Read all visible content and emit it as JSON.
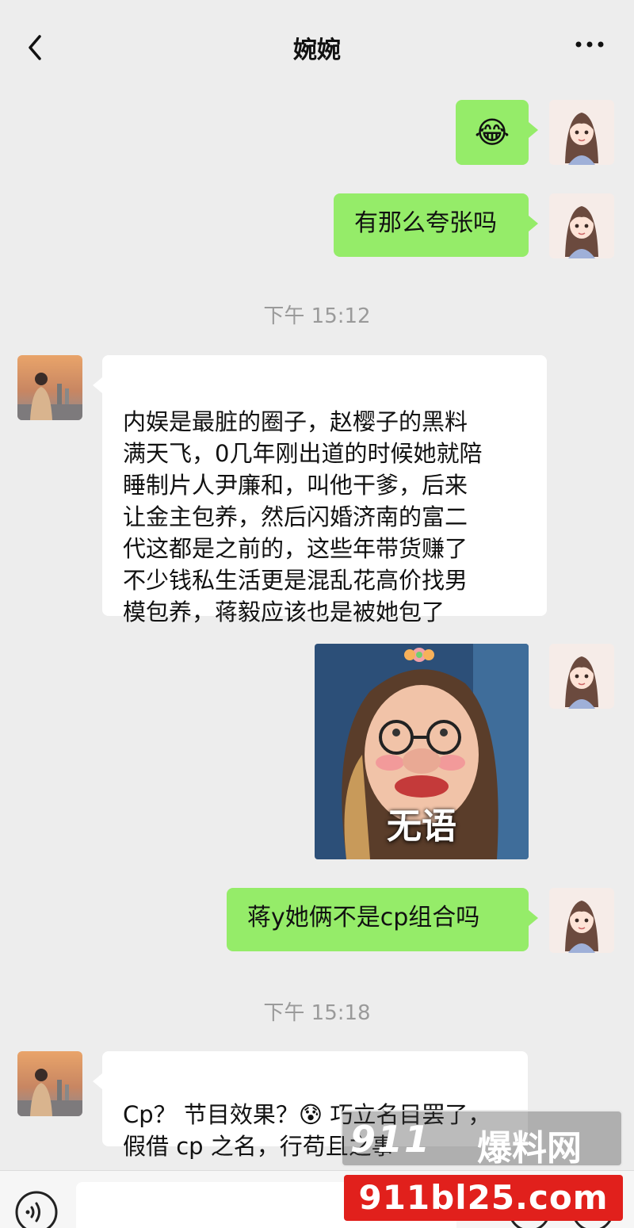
{
  "header": {
    "title": "婉婉"
  },
  "messages": {
    "m1": {
      "sender": "me",
      "content": "😂"
    },
    "m2": {
      "sender": "me",
      "content": "有那么夸张吗"
    },
    "t1": {
      "time": "下午 15:12"
    },
    "m3": {
      "sender": "other",
      "content": "内娱是最脏的圈子，赵樱子的黑料\n满天飞，0几年刚出道的时候她就陪\n睡制片人尹廉和，叫他干爹，后来\n让金主包养，然后闪婚济南的富二\n代这都是之前的，这些年带货赚了\n不少钱私生活更是混乱花高价找男\n模包养，蒋毅应该也是被她包了"
    },
    "m4": {
      "sender": "me",
      "type": "sticker",
      "caption": "无语"
    },
    "m5": {
      "sender": "me",
      "content": "蒋y她俩不是cp组合吗"
    },
    "t2": {
      "time": "下午 15:18"
    },
    "m6": {
      "sender": "other",
      "content": "Cp？ 节目效果？😰 巧立名目罢了，\n假借 cp 之名，行苟且之事"
    }
  },
  "watermark": {
    "brand": "911",
    "site_name": "爆料网",
    "url": "911bl25.com"
  },
  "colors": {
    "background": "#ededed",
    "my_bubble": "#95ec69",
    "other_bubble": "#ffffff",
    "watermark_red": "#e1201c"
  },
  "icons": [
    "back-icon",
    "more-icon",
    "voice-icon",
    "emoji-icon",
    "plus-icon"
  ]
}
